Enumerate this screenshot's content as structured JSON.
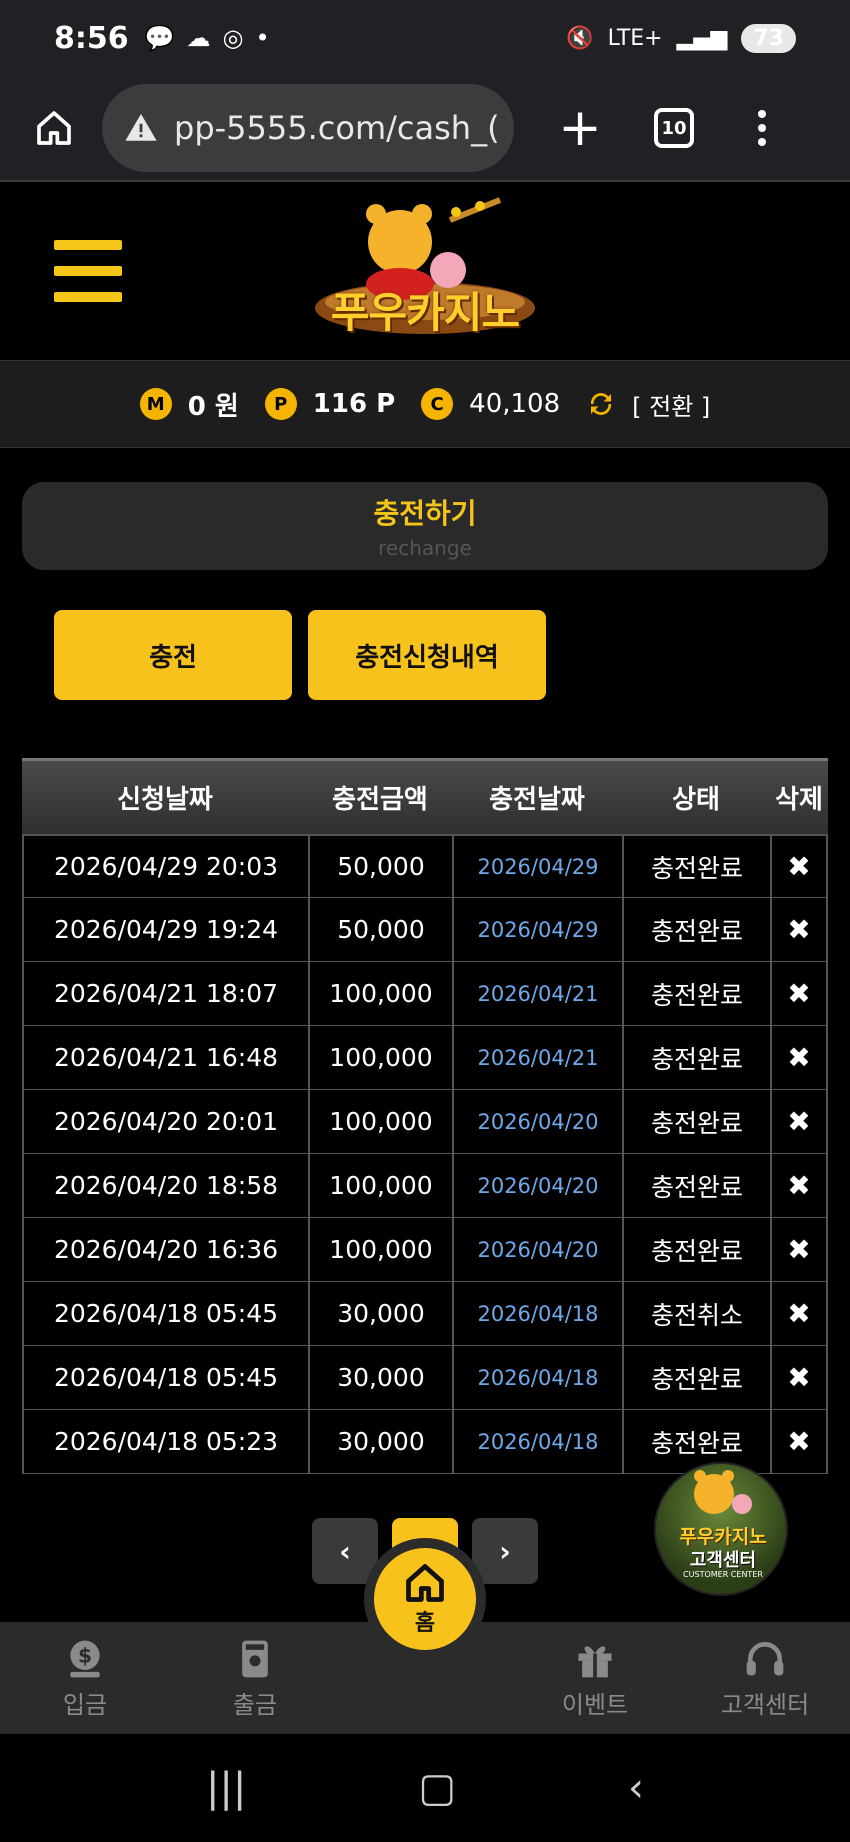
{
  "status": {
    "time": "8:56",
    "network": "LTE+",
    "battery": "73"
  },
  "browser": {
    "url": "pp-5555.com/cash_(",
    "tab_count": "10"
  },
  "site": {
    "logo_text": "푸우카지노"
  },
  "balance": {
    "money_icon": "M",
    "money": "0 원",
    "point_icon": "P",
    "point": "116 P",
    "casino_icon": "C",
    "casino": "40,108",
    "convert_label": "[ 전환 ]"
  },
  "section": {
    "title": "충전하기",
    "subtitle": "rechange"
  },
  "buttons": {
    "charge": "충전",
    "history": "충전신청내역"
  },
  "table": {
    "headers": [
      "신청날짜",
      "충전금액",
      "충전날짜",
      "상태",
      "삭제"
    ],
    "rows": [
      {
        "requested": "2026/04/29 20:03",
        "amount": "50,000",
        "charged": "2026/04/29",
        "status": "충전완료",
        "delete": "✖"
      },
      {
        "requested": "2026/04/29 19:24",
        "amount": "50,000",
        "charged": "2026/04/29",
        "status": "충전완료",
        "delete": "✖"
      },
      {
        "requested": "2026/04/21 18:07",
        "amount": "100,000",
        "charged": "2026/04/21",
        "status": "충전완료",
        "delete": "✖"
      },
      {
        "requested": "2026/04/21 16:48",
        "amount": "100,000",
        "charged": "2026/04/21",
        "status": "충전완료",
        "delete": "✖"
      },
      {
        "requested": "2026/04/20 20:01",
        "amount": "100,000",
        "charged": "2026/04/20",
        "status": "충전완료",
        "delete": "✖"
      },
      {
        "requested": "2026/04/20 18:58",
        "amount": "100,000",
        "charged": "2026/04/20",
        "status": "충전완료",
        "delete": "✖"
      },
      {
        "requested": "2026/04/20 16:36",
        "amount": "100,000",
        "charged": "2026/04/20",
        "status": "충전완료",
        "delete": "✖"
      },
      {
        "requested": "2026/04/18 05:45",
        "amount": "30,000",
        "charged": "2026/04/18",
        "status": "충전취소",
        "delete": "✖"
      },
      {
        "requested": "2026/04/18 05:45",
        "amount": "30,000",
        "charged": "2026/04/18",
        "status": "충전완료",
        "delete": "✖"
      },
      {
        "requested": "2026/04/18 05:23",
        "amount": "30,000",
        "charged": "2026/04/18",
        "status": "충전완료",
        "delete": "✖"
      }
    ]
  },
  "pagination": {
    "prev": "‹",
    "current": "1",
    "next": "›"
  },
  "customer_center_badge": {
    "logo_text": "푸우카지노",
    "label": "고객센터",
    "sublabel": "CUSTOMER CENTER"
  },
  "bottom_nav": {
    "deposit": "입금",
    "withdraw": "출금",
    "home": "홈",
    "event": "이벤트",
    "support": "고객센터"
  },
  "colors": {
    "accent": "#f8c21c",
    "link_date": "#6ea9e8",
    "background": "#000000"
  }
}
